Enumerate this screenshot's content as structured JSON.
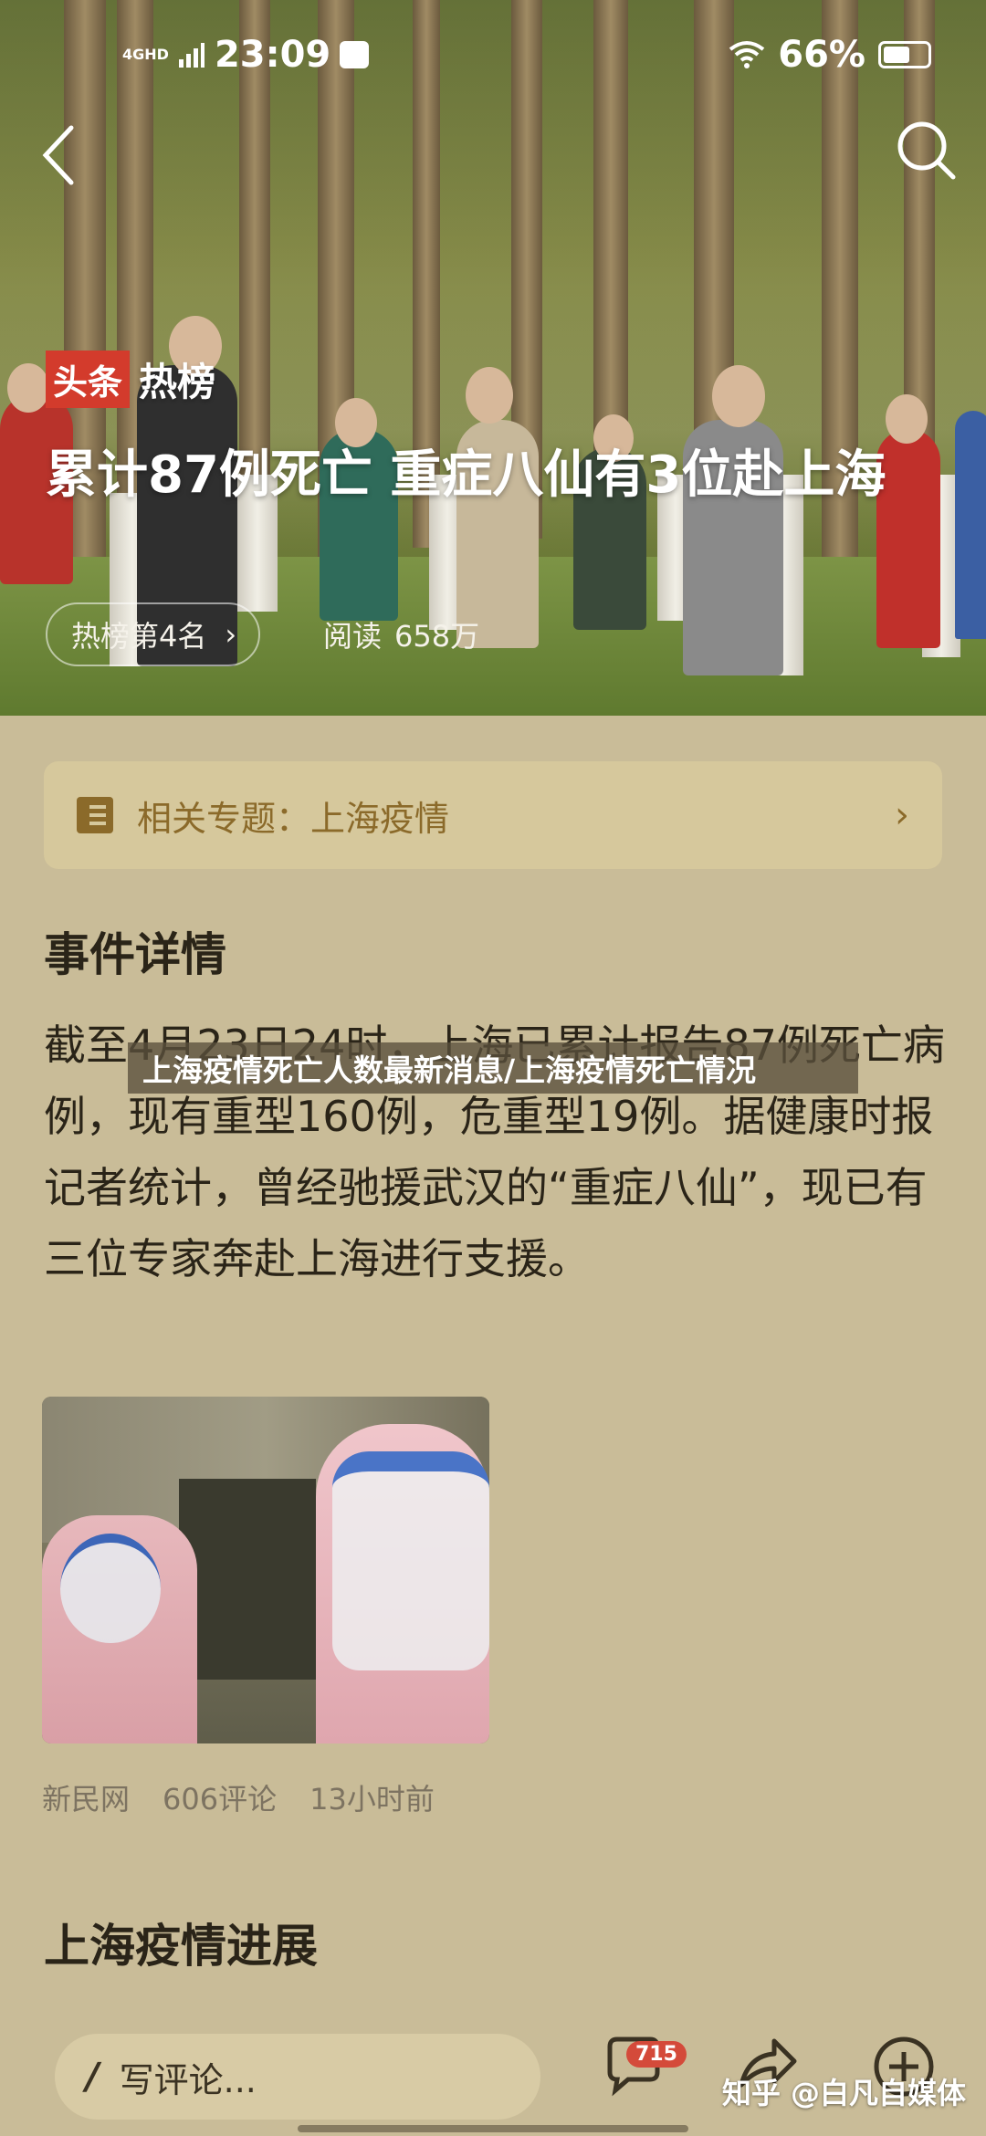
{
  "status_bar": {
    "network": "4GHD",
    "time": "23:09",
    "battery": "66%"
  },
  "hero": {
    "badge_red": "头条",
    "badge_white": "热榜",
    "title": "累计87例死亡 重症八仙有3位赴上海",
    "rank_label": "热榜第4名",
    "rank_chevron": "›",
    "reads_label": "阅读",
    "reads_count": "658万"
  },
  "topic": {
    "label": "相关专题：上海疫情",
    "chevron": "›"
  },
  "overlay_banner": "上海疫情死亡人数最新消息/上海疫情死亡情况",
  "section1": {
    "heading": "事件详情",
    "body": "截至4月23日24时，上海已累计报告87例死亡病例，现有重型160例，危重型19例。据健康时报记者统计，曾经驰援武汉的“重症八仙”，现已有三位专家奔赴上海进行支援。"
  },
  "source_meta": {
    "source": "新民网",
    "comments": "606评论",
    "time": "13小时前"
  },
  "section2": {
    "heading": "上海疫情进展"
  },
  "bottom_bar": {
    "comment_placeholder": "写评论...",
    "comment_badge": "715"
  },
  "watermark": "知乎 @白凡自媒体",
  "colors": {
    "accent_red": "#d33b2c",
    "topic_brown": "#8b6a2a",
    "page_bg": "#c9bc98"
  },
  "icons": [
    "back-icon",
    "search-icon",
    "topic-book-icon",
    "chevron-right-icon",
    "pen-icon",
    "comment-icon",
    "share-icon",
    "add-icon"
  ]
}
